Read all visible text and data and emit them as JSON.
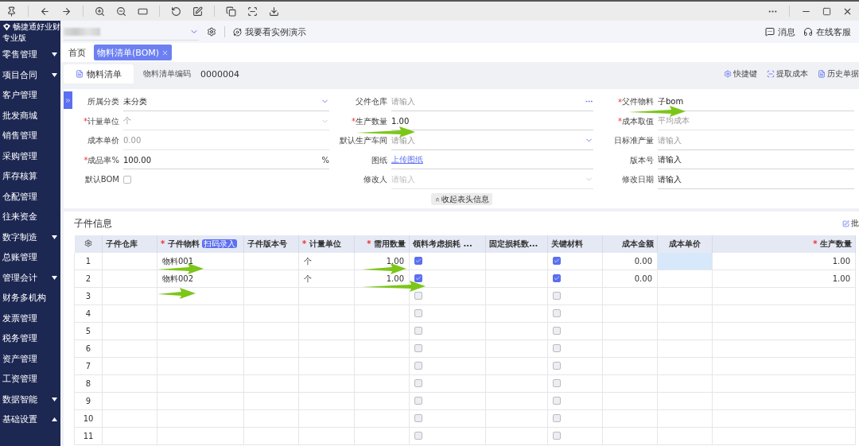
{
  "brand": {
    "name": "畅捷通好业财",
    "edition": "专业版"
  },
  "header": {
    "demo_link": "我要看实例演示",
    "messages": "消息",
    "support": "在线客服"
  },
  "sidebar": {
    "items": [
      {
        "label": "零售管理",
        "kind": "group",
        "expanded": false
      },
      {
        "label": "项目合同",
        "kind": "group",
        "expanded": false
      },
      {
        "label": "客户管理",
        "kind": "page"
      },
      {
        "label": "批发商城",
        "kind": "page"
      },
      {
        "label": "销售管理",
        "kind": "page"
      },
      {
        "label": "采购管理",
        "kind": "page"
      },
      {
        "label": "库存核算",
        "kind": "page"
      },
      {
        "label": "仓配管理",
        "kind": "page"
      },
      {
        "label": "往来资金",
        "kind": "page"
      },
      {
        "label": "数字制造",
        "kind": "group",
        "expanded": false
      },
      {
        "label": "总账管理",
        "kind": "page"
      },
      {
        "label": "管理会计",
        "kind": "group",
        "expanded": false
      },
      {
        "label": "财务多机构",
        "kind": "page"
      },
      {
        "label": "发票管理",
        "kind": "page"
      },
      {
        "label": "税务管理",
        "kind": "page"
      },
      {
        "label": "资产管理",
        "kind": "page"
      },
      {
        "label": "工资管理",
        "kind": "page"
      },
      {
        "label": "数据智能",
        "kind": "group",
        "expanded": false
      },
      {
        "label": "基础设置",
        "kind": "group",
        "expanded": true
      }
    ]
  },
  "tabs": [
    {
      "label": "首页",
      "selected": false,
      "closable": false
    },
    {
      "label": "物料清单(BOM)",
      "selected": true,
      "closable": true
    }
  ],
  "document": {
    "tab": "物料清单",
    "code_label": "物料清单编码",
    "code": "0000004",
    "actions": [
      {
        "kind": "shortcut",
        "label": "快捷键"
      },
      {
        "kind": "extract",
        "label": "提取成本"
      },
      {
        "kind": "history",
        "label": "历史单据"
      }
    ]
  },
  "form": {
    "columns": [
      [
        {
          "label": "所属分类",
          "kind": "select",
          "disabled": false,
          "value": "未分类"
        },
        {
          "label": "计量单位",
          "kind": "select",
          "required_mark": "*",
          "disabled": true,
          "value": "个"
        },
        {
          "label": "成本单价",
          "kind": "text",
          "disabled": true,
          "value": "0.00"
        },
        {
          "label": "成品率%",
          "kind": "text",
          "required_mark": "*",
          "disabled": false,
          "value": "100.00",
          "suffix": "%"
        },
        {
          "label": "默认BOM",
          "kind": "checkbox",
          "checked": false
        }
      ],
      [
        {
          "label": "父件仓库",
          "kind": "lookup",
          "disabled": false,
          "placeholder": "请输入"
        },
        {
          "label": "生产数量",
          "kind": "text",
          "required_mark": "*",
          "disabled": false,
          "value": "1.00"
        },
        {
          "label": "默认生产车间",
          "kind": "select",
          "disabled": false,
          "placeholder": "请输入"
        },
        {
          "label": "图纸",
          "kind": "link",
          "value": "上传图纸"
        },
        {
          "label": "修改人",
          "kind": "select",
          "disabled": true,
          "placeholder": "请输入"
        }
      ],
      [
        {
          "label": "父件物料",
          "kind": "text",
          "required_mark": "*",
          "disabled": false,
          "value": "子bom"
        },
        {
          "label": "成本取值",
          "kind": "text",
          "required_mark": "*",
          "disabled": true,
          "value": "平均成本"
        },
        {
          "label": "日标准产量",
          "kind": "text",
          "disabled": false,
          "placeholder": "请输入"
        },
        {
          "label": "版本号",
          "kind": "text",
          "disabled": false,
          "value": "请输入"
        },
        {
          "label": "修改日期",
          "kind": "text",
          "disabled": false,
          "value": "请输入"
        }
      ]
    ],
    "collapse_button": "收起表头信息"
  },
  "components": {
    "title": "子件信息",
    "batch": "批",
    "scan_badge": "扫码录入",
    "columns": [
      {
        "label": "子件仓库"
      },
      {
        "label": "子件物料",
        "required_mark": "*"
      },
      {
        "label": "子件版本号"
      },
      {
        "label": "计量单位",
        "required_mark": "*"
      },
      {
        "label": "需用数量",
        "required_mark": "*"
      },
      {
        "label": "领料考虑损耗 ..."
      },
      {
        "label": "固定损耗数..."
      },
      {
        "label": "关键材料"
      },
      {
        "label": "成本金额"
      },
      {
        "label": "成本单价"
      },
      {
        "label": "生产数量",
        "required_mark": "*"
      }
    ],
    "rows": [
      {
        "no": "1",
        "material": "物料001",
        "unit": "个",
        "qty": "1.00",
        "consider_loss": true,
        "key_material": true,
        "cost_amount": "0.00",
        "production_qty": "1.00",
        "unit_cost_selected": true
      },
      {
        "no": "2",
        "material": "物料002",
        "unit": "个",
        "qty": "1.00",
        "consider_loss": true,
        "key_material": true,
        "cost_amount": "0.00",
        "production_qty": "1.00",
        "unit_cost_selected": false
      },
      {
        "no": "3",
        "consider_loss": false,
        "key_material": false,
        "unit_cost_selected": false
      },
      {
        "no": "4",
        "consider_loss": false,
        "key_material": false,
        "unit_cost_selected": false
      },
      {
        "no": "5",
        "consider_loss": false,
        "key_material": false,
        "unit_cost_selected": false
      },
      {
        "no": "6",
        "consider_loss": false,
        "key_material": false,
        "unit_cost_selected": false
      },
      {
        "no": "7",
        "consider_loss": false,
        "key_material": false,
        "unit_cost_selected": false
      },
      {
        "no": "8",
        "consider_loss": false,
        "key_material": false,
        "unit_cost_selected": false
      },
      {
        "no": "9",
        "consider_loss": false,
        "key_material": false,
        "unit_cost_selected": false
      },
      {
        "no": "10",
        "consider_loss": false,
        "key_material": false,
        "unit_cost_selected": false
      },
      {
        "no": "11",
        "consider_loss": false,
        "key_material": false,
        "unit_cost_selected": false
      }
    ]
  }
}
